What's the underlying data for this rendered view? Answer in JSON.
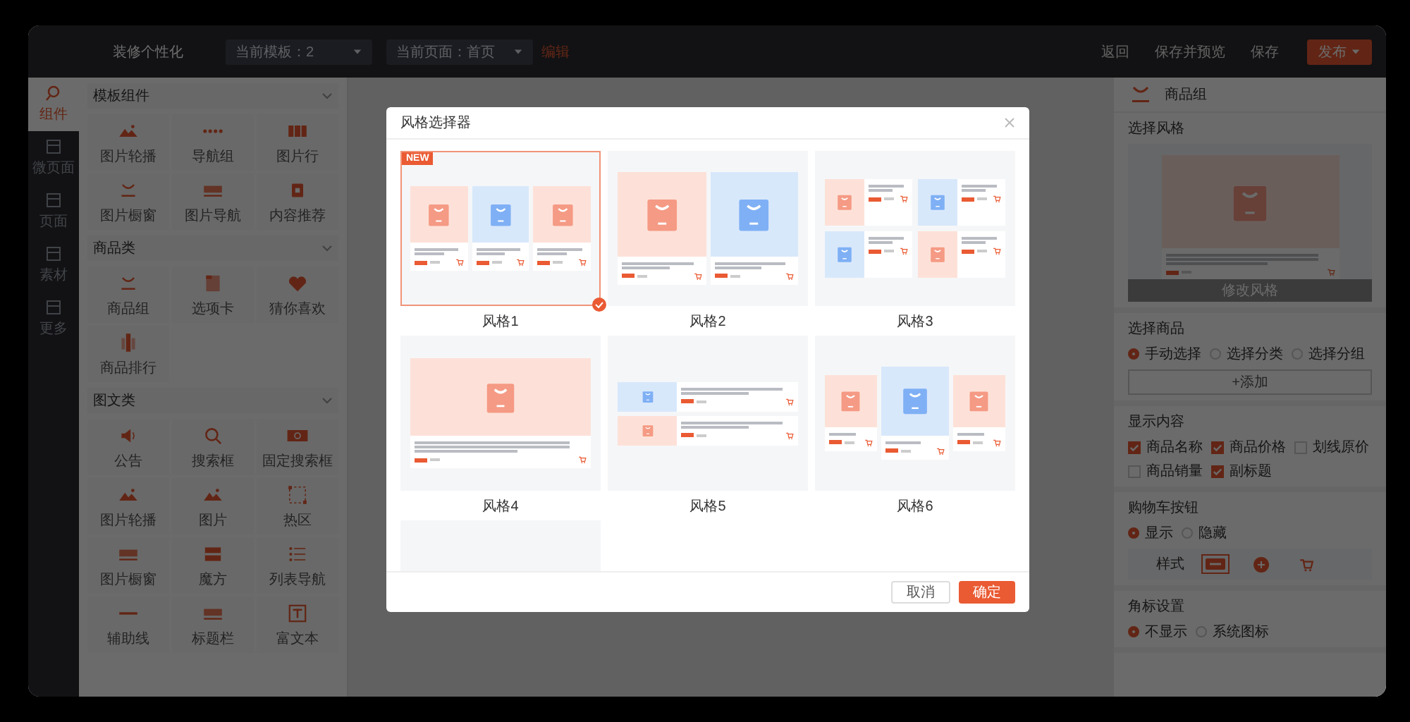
{
  "topbar": {
    "title": "装修个性化",
    "template_select": "当前模板：2",
    "page_select": "当前页面：首页",
    "edit_link": "编辑",
    "actions": [
      "返回",
      "保存并预览",
      "保存"
    ],
    "publish": "发布"
  },
  "rail": [
    {
      "label": "组件",
      "selected": true
    },
    {
      "label": "微页面",
      "selected": false
    },
    {
      "label": "页面",
      "selected": false
    },
    {
      "label": "素材",
      "selected": false
    },
    {
      "label": "更多",
      "selected": false
    }
  ],
  "component_groups": [
    {
      "title": "模板组件",
      "expanded": true,
      "items": [
        "图片轮播",
        "导航组",
        "图片行",
        "图片橱窗",
        "图片导航",
        "内容推荐"
      ]
    },
    {
      "title": "商品类",
      "expanded": true,
      "items": [
        "商品组",
        "选项卡",
        "猜你喜欢",
        "商品排行"
      ]
    },
    {
      "title": "图文类",
      "expanded": true,
      "items": [
        "公告",
        "搜索框",
        "固定搜索框",
        "图片轮播",
        "图片",
        "热区",
        "图片橱窗",
        "魔方",
        "列表导航",
        "辅助线",
        "标题栏",
        "富文本"
      ]
    }
  ],
  "modal": {
    "title": "风格选择器",
    "styles": [
      {
        "kind": "grid3",
        "label": "风格1",
        "selected": true,
        "badge": "NEW"
      },
      {
        "kind": "grid2",
        "label": "风格2",
        "selected": false
      },
      {
        "kind": "list2x2",
        "label": "风格3",
        "selected": false
      },
      {
        "kind": "single",
        "label": "风格4",
        "selected": false
      },
      {
        "kind": "list",
        "label": "风格5",
        "selected": false
      },
      {
        "kind": "carousel",
        "label": "风格6",
        "selected": false
      },
      {
        "kind": "strip",
        "selected": false
      }
    ],
    "cancel": "取消",
    "confirm": "确定"
  },
  "settings": {
    "title": "商品组",
    "style_section": {
      "title": "选择风格",
      "button": "修改风格"
    },
    "product_section": {
      "title": "选择商品",
      "options": [
        {
          "label": "手动选择",
          "selected": true
        },
        {
          "label": "选择分类",
          "selected": false
        },
        {
          "label": "选择分组",
          "selected": false
        }
      ],
      "add_button": "+添加"
    },
    "display_section": {
      "title": "显示内容",
      "options": [
        {
          "label": "商品名称",
          "checked": true
        },
        {
          "label": "商品价格",
          "checked": true
        },
        {
          "label": "划线原价",
          "checked": false
        },
        {
          "label": "商品销量",
          "checked": false
        },
        {
          "label": "副标题",
          "checked": true
        }
      ]
    },
    "cart_section": {
      "title": "购物车按钮",
      "options": [
        {
          "label": "显示",
          "selected": true
        },
        {
          "label": "隐藏",
          "selected": false
        }
      ],
      "style_label": "样式",
      "styles": [
        {
          "kind": "tag",
          "selected": true
        },
        {
          "kind": "circle",
          "selected": false
        },
        {
          "kind": "cart",
          "selected": false
        }
      ]
    },
    "badge_section": {
      "title": "角标设置",
      "options": [
        {
          "label": "不显示",
          "selected": true
        },
        {
          "label": "系统图标",
          "selected": false
        }
      ]
    }
  }
}
